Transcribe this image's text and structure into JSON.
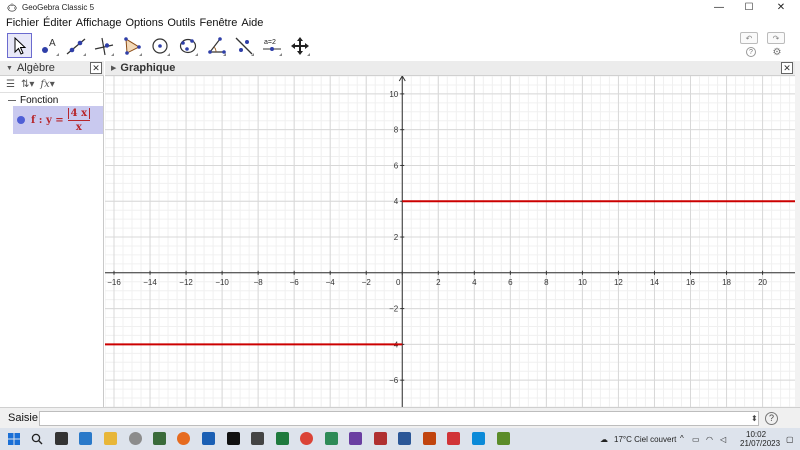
{
  "window": {
    "title": "GeoGebra Classic 5",
    "controls": [
      "—",
      "☐",
      "✕"
    ]
  },
  "menubar": {
    "items": [
      "Fichier",
      "Éditer",
      "Affichage",
      "Options",
      "Outils",
      "Fenêtre",
      "Aide"
    ]
  },
  "toolbar": {
    "tools": [
      {
        "icon": "move-arrow-icon",
        "selected": true
      },
      {
        "icon": "point-icon",
        "label": "A"
      },
      {
        "icon": "line-icon"
      },
      {
        "icon": "perpendicular-line-icon"
      },
      {
        "icon": "polygon-icon"
      },
      {
        "icon": "circle-center-point-icon"
      },
      {
        "icon": "circle-three-points-icon"
      },
      {
        "icon": "angle-icon"
      },
      {
        "icon": "reflect-icon"
      },
      {
        "icon": "slider-icon",
        "label": "a=2"
      },
      {
        "icon": "move-graphics-icon"
      }
    ]
  },
  "algebra": {
    "title": "Algèbre",
    "category": "Fonction",
    "object": {
      "name": "f",
      "prefix": "f : y =",
      "numerator": "4 x",
      "denominator": "x",
      "color": "#b7262b"
    }
  },
  "graphics": {
    "title": "Graphique",
    "x_range": [
      -16.5,
      21.8
    ],
    "y_range": [
      -7.5,
      11.0
    ],
    "x_ticks": [
      -16,
      -14,
      -12,
      -10,
      -8,
      -6,
      -4,
      -2,
      0,
      2,
      4,
      6,
      8,
      10,
      12,
      14,
      16,
      18,
      20
    ],
    "y_ticks": [
      -6,
      -4,
      -2,
      2,
      4,
      6,
      8,
      10
    ],
    "function_color": "#cc0000",
    "segments": [
      {
        "x_from": -16.5,
        "x_to": 0,
        "y": -4
      },
      {
        "x_from": 0,
        "x_to": 21.8,
        "y": 4
      }
    ]
  },
  "input": {
    "label": "Saisie:",
    "value": ""
  },
  "taskbar": {
    "weather": "17°C  Ciel couvert",
    "time": "10:02",
    "date": "21/07/2023"
  }
}
